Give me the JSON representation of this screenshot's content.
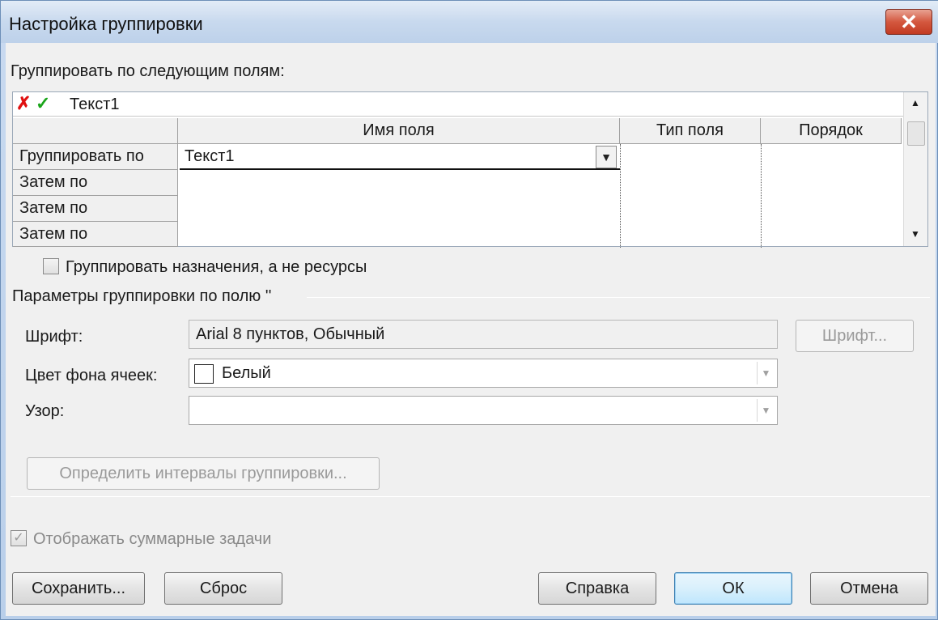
{
  "window": {
    "title": "Настройка группировки",
    "close_glyph": "✕"
  },
  "group_by_label": "Группировать по следующим полям:",
  "grid": {
    "edit_value": "Текст1",
    "cancel_glyph": "✗",
    "ok_glyph": "✓",
    "columns": [
      "Имя поля",
      "Тип поля",
      "Порядок"
    ],
    "rows": [
      {
        "label": "Группировать по",
        "field": "Текст1"
      },
      {
        "label": "Затем по",
        "field": ""
      },
      {
        "label": "Затем по",
        "field": ""
      },
      {
        "label": "Затем по",
        "field": ""
      }
    ],
    "scroll_up": "▲",
    "scroll_down": "▼",
    "dropdown_glyph": "▼"
  },
  "group_assignments_label": "Группировать назначения, а не ресурсы",
  "params": {
    "heading": "Параметры группировки по полю ''",
    "font_label": "Шрифт:",
    "font_value": "Arial 8 пунктов, Обычный",
    "font_button": "Шрифт...",
    "bg_color_label": "Цвет фона ячеек:",
    "bg_color_value": "Белый",
    "pattern_label": "Узор:",
    "pattern_value": "",
    "intervals_button": "Определить интервалы группировки..."
  },
  "show_summary_label": "Отображать суммарные задачи",
  "buttons": {
    "save": "Сохранить...",
    "reset": "Сброс",
    "help": "Справка",
    "ok": "ОК",
    "cancel": "Отмена"
  },
  "colors": {
    "title_bar": "#c8d9ee",
    "close": "#c23a22",
    "dialog_bg": "#f0f0f0",
    "cell_bg_swatch": "#ffffff"
  }
}
